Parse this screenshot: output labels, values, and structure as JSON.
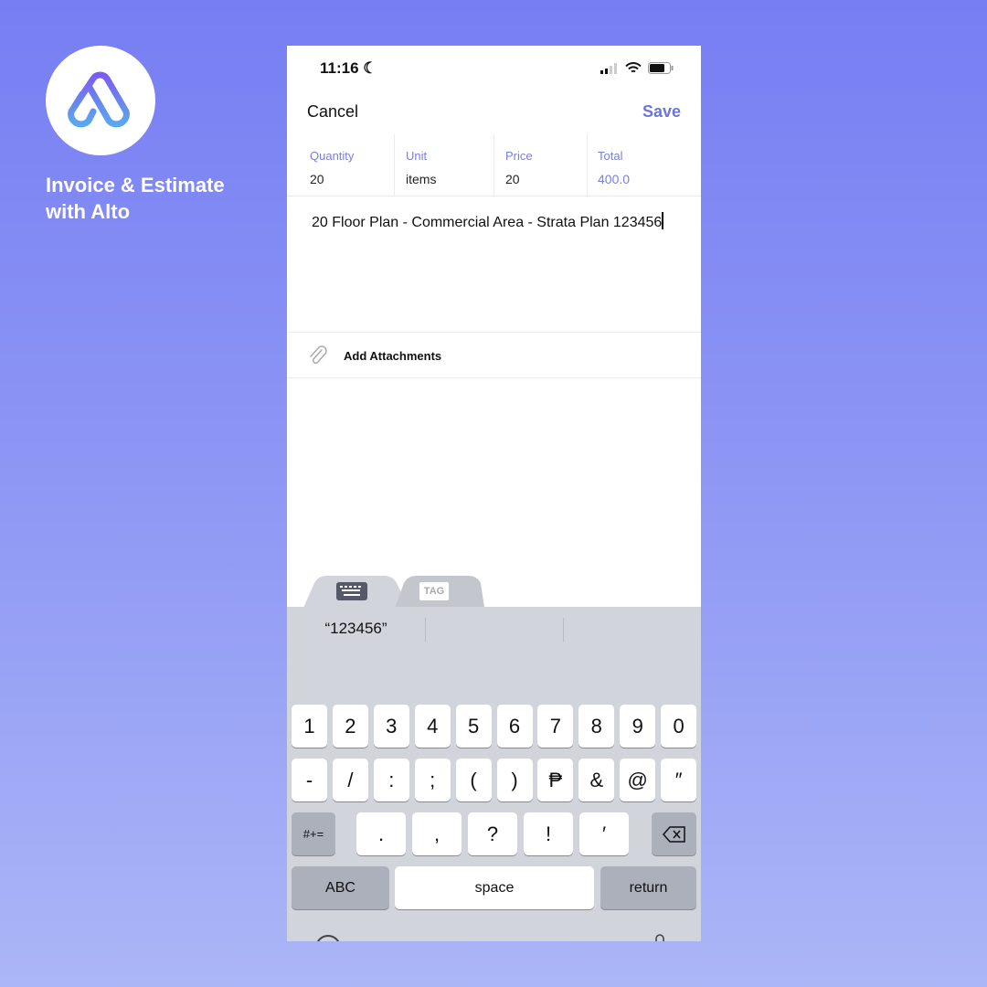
{
  "brand": {
    "title_line1": "Invoice & Estimate",
    "title_line2": "with Alto",
    "logo": "alto-logo"
  },
  "status": {
    "time": "11:16"
  },
  "nav": {
    "cancel": "Cancel",
    "save": "Save",
    "accent": "#6f74db"
  },
  "fields": [
    {
      "label": "Quantity",
      "value": "20"
    },
    {
      "label": "Unit",
      "value": "items"
    },
    {
      "label": "Price",
      "value": "20"
    },
    {
      "label": "Total",
      "value": "400.0"
    }
  ],
  "description": "20 Floor Plan - Commercial Area - Strata Plan 123456",
  "attachments": {
    "label": "Add Attachments"
  },
  "toolbar": {
    "tag": "TAG"
  },
  "suggestion": "“123456”",
  "keys": {
    "row1": [
      "1",
      "2",
      "3",
      "4",
      "5",
      "6",
      "7",
      "8",
      "9",
      "0"
    ],
    "row2": [
      "-",
      "/",
      ":",
      ";",
      "(",
      ")",
      "₱",
      "&",
      "@",
      "″"
    ],
    "row3": [
      ".",
      ",",
      "?",
      "!",
      "′"
    ],
    "symbols": "#+=",
    "abc": "ABC",
    "space": "space",
    "return": "return"
  }
}
